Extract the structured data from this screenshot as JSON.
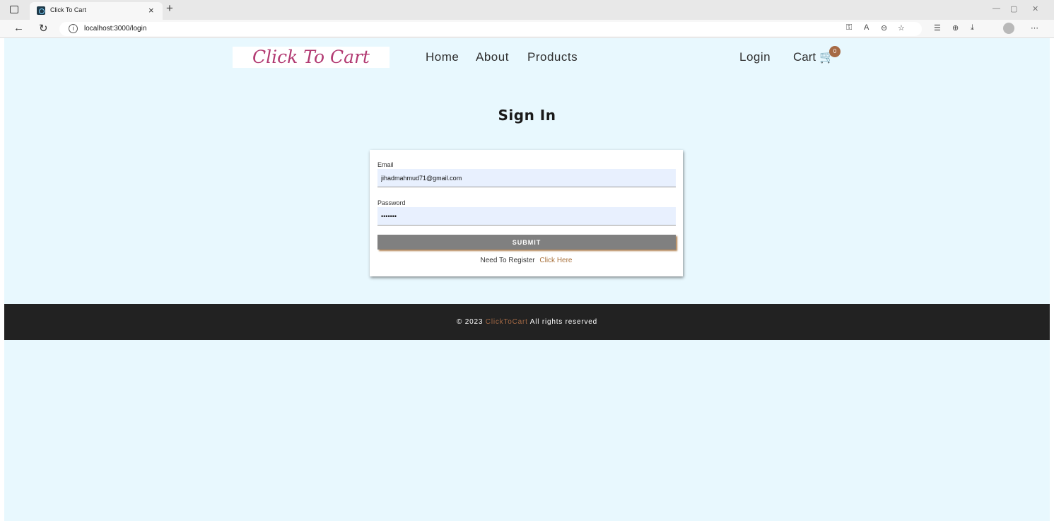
{
  "browser": {
    "tab_title": "Click To Cart",
    "tab_close": "×",
    "new_tab": "+",
    "url": "localhost:3000/login",
    "controls": {
      "minimize": "—",
      "restore": "▢",
      "close": "✕"
    },
    "toolbar_icons": [
      "key-icon",
      "read-aloud-icon",
      "zoom-icon",
      "favorite-icon",
      "favorites-icon",
      "collections-icon",
      "download-icon",
      "profile-icon",
      "more-icon"
    ]
  },
  "nav": {
    "logo": "Click To Cart",
    "links": [
      "Home",
      "About",
      "Products"
    ],
    "login": "Login",
    "cart": "Cart",
    "cart_count": "0"
  },
  "main": {
    "heading": "Sign In",
    "form": {
      "email_label": "Email",
      "email_value": "jihadmahmud71@gmail.com",
      "password_label": "Password",
      "password_value": "•••••••",
      "submit": "SUBMIT",
      "register_text": "Need To Register",
      "register_link": "Click Here"
    }
  },
  "footer": {
    "prefix": "© 2023",
    "brand": "ClickToCart",
    "suffix": "All rights reserved"
  },
  "colors": {
    "page_bg": "#e8f8fe",
    "logo": "#b23a72",
    "accent": "#a66a45",
    "footer_bg": "#222222",
    "submit_bg": "#808080",
    "input_bg": "#e8f0fe"
  }
}
